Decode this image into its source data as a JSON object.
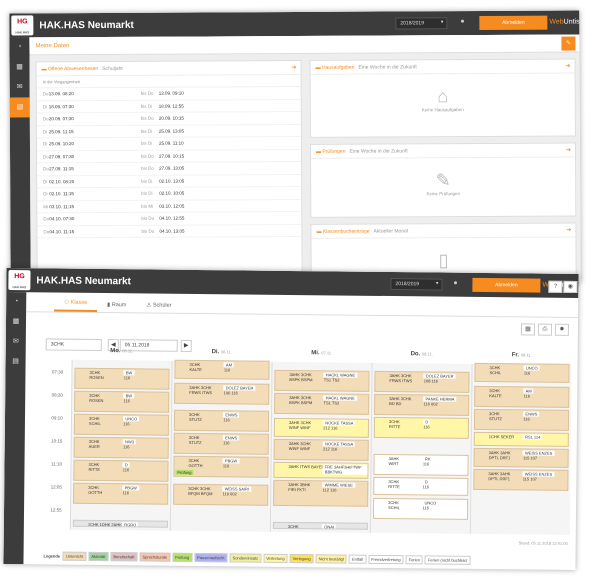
{
  "school": "HAK.HAS Neumarkt",
  "logo": "HG",
  "logo_sub": "HAK.HAS",
  "brand_a": "Web",
  "brand_b": "Untis",
  "year": "2018/2019",
  "logout": "Abmelden",
  "w1": {
    "title": "Meine Daten",
    "absences": {
      "title": "Offene Abwesenheiten",
      "subtitle": "Schuljahr",
      "section": "In der Vergangenheit",
      "rows": [
        [
          "Do",
          "13.09.",
          "08:20",
          "bis Do",
          "13.09.",
          "09:10"
        ],
        [
          "Di",
          "18.09.",
          "07:30",
          "bis Di",
          "18.09.",
          "12:55"
        ],
        [
          "Do",
          "20.09.",
          "07:30",
          "bis Do",
          "20.09.",
          "10:15"
        ],
        [
          "Di",
          "25.09.",
          "11:15",
          "bis Di",
          "25.09.",
          "13:05"
        ],
        [
          "Di",
          "25.09.",
          "10:20",
          "bis Di",
          "25.09.",
          "11:10"
        ],
        [
          "Do",
          "27.09.",
          "07:30",
          "bis Do",
          "27.09.",
          "10:15"
        ],
        [
          "Do",
          "27.09.",
          "11:15",
          "bis Do",
          "27.09.",
          "13:05"
        ],
        [
          "Di",
          "02.10.",
          "08:20",
          "bis Di",
          "02.10.",
          "13:05"
        ],
        [
          "Di",
          "02.10.",
          "11:15",
          "bis Di",
          "02.10.",
          "10:05"
        ],
        [
          "Mi",
          "03.10.",
          "11:15",
          "bis Mi",
          "03.10.",
          "12:05"
        ],
        [
          "Do",
          "04.10.",
          "07:30",
          "bis Do",
          "04.10.",
          "12:55"
        ],
        [
          "Do",
          "04.10.",
          "11:15",
          "bis Do",
          "04.10.",
          "13:05"
        ]
      ]
    },
    "homework": {
      "title": "Hausaufgaben",
      "subtitle": "Eine Woche in die Zukunft",
      "empty": "Keine Hausaufgaben"
    },
    "exams": {
      "title": "Prüfungen",
      "subtitle": "Eine Woche in die Zukunft",
      "empty": "Keine Prüfungen"
    },
    "classbook": {
      "title": "Klassenbucheinträge",
      "subtitle": "Aktueller Monat"
    }
  },
  "w2": {
    "tabs": [
      "Klasse",
      "Raum",
      "Schüler"
    ],
    "class_select": "3CHK",
    "date": "05.11.2018",
    "days": [
      {
        "d": "Mo.",
        "dt": "05.11."
      },
      {
        "d": "Di.",
        "dt": "06.11."
      },
      {
        "d": "Mi.",
        "dt": "07.11."
      },
      {
        "d": "Do.",
        "dt": "08.11."
      },
      {
        "d": "Fr.",
        "dt": "09.11."
      }
    ],
    "times": [
      "07:30",
      "08:20",
      "09:10",
      "10:15",
      "11:10",
      "12:05",
      "12:55"
    ],
    "stand": "Stand: 05.11.2018 13:41:00",
    "legend_title": "Legende",
    "legend": [
      {
        "t": "Unterricht",
        "c": "#f3ddb8"
      },
      {
        "t": "Aktivität",
        "c": "#9fd39f"
      },
      {
        "t": "Bereitschaft",
        "c": "#e0c0c0"
      },
      {
        "t": "Sprechstunde",
        "c": "#f6c3b0"
      },
      {
        "t": "Prüfung",
        "c": "#b5e06b"
      },
      {
        "t": "Pausenaufsicht",
        "c": "#b0b0ef"
      },
      {
        "t": "Sondereinsatz",
        "c": "#f0f0a0"
      },
      {
        "t": "Vertretung",
        "c": "#fff6a8"
      },
      {
        "t": "Verlegung",
        "c": "#ffe04f"
      },
      {
        "t": "Nicht bestätigt",
        "c": "#fff3a0"
      },
      {
        "t": "Entfall",
        "c": "#fff"
      },
      {
        "t": "Fremdvertretung",
        "c": "#fff"
      },
      {
        "t": "Ferien",
        "c": "#fff"
      },
      {
        "t": "Ferien (nicht buchbar)",
        "c": "#fff"
      }
    ],
    "lessons": [
      {
        "day": 0,
        "s": 0,
        "l": 1,
        "cls": "3CHK",
        "sub": "ROSEN",
        "rm": "BW",
        "tc": "116"
      },
      {
        "day": 0,
        "s": 1,
        "l": 1,
        "cls": "3CHK",
        "sub": "ROSEN",
        "rm": "BW",
        "tc": "116"
      },
      {
        "day": 0,
        "s": 2,
        "l": 1,
        "cls": "3CHK",
        "sub": "SCHIL",
        "rm": "UNCO",
        "tc": "116"
      },
      {
        "day": 0,
        "s": 3,
        "l": 1,
        "cls": "3CHK",
        "sub": "AUER",
        "rm": "NW3",
        "tc": "116"
      },
      {
        "day": 0,
        "s": 4,
        "l": 1,
        "cls": "3CHK",
        "sub": "RITTE",
        "rm": "D",
        "tc": "116"
      },
      {
        "day": 0,
        "s": 5,
        "l": 1,
        "cls": "3CHK",
        "sub": "GOTTH",
        "rm": "PBGW",
        "tc": "116"
      },
      {
        "day": 0,
        "s": 6.6,
        "l": 0.4,
        "cls": "1CHK 1DHK 2AHK",
        "sub": "",
        "rm": "RGRO",
        "tc": "",
        "g": 1
      },
      {
        "day": 1,
        "s": -0.4,
        "l": 0.9,
        "cls": "3CHK",
        "sub": "KALTE",
        "rm": "AM",
        "tc": "116"
      },
      {
        "day": 1,
        "s": 0.6,
        "l": 1,
        "cls": "3AHK 3CHK",
        "sub": "FRWS ITWS",
        "rm": "DOLEZ BAYER",
        "tc": "106 116"
      },
      {
        "day": 1,
        "s": 1.8,
        "l": 1,
        "cls": "3CHK",
        "sub": "STUTZ",
        "rm": "ENWS",
        "tc": "116"
      },
      {
        "day": 1,
        "s": 2.8,
        "l": 1,
        "cls": "3CHK",
        "sub": "STUTZ",
        "rm": "ENWS",
        "tc": "116"
      },
      {
        "day": 1,
        "s": 3.8,
        "l": 1,
        "cls": "3CHK",
        "sub": "GOTTH",
        "rm": "PBGW",
        "tc": "116",
        "p": 1
      },
      {
        "day": 1,
        "s": 5,
        "l": 1,
        "cls": "3CHK 3CHK",
        "sub": "BFQM BFQM",
        "rm": "WEISS SAIRI",
        "tc": "116 002"
      },
      {
        "day": 2,
        "s": 0,
        "l": 1,
        "cls": "3AHK 3CHK",
        "sub": "BSPK BSPM",
        "rm": "HACKL WAGNE",
        "tc": "TS1 TS2"
      },
      {
        "day": 2,
        "s": 1,
        "l": 1,
        "cls": "3AHK 3CHK",
        "sub": "BSPK BSPM",
        "rm": "HACKL WAGNE",
        "tc": "TS1 TS2"
      },
      {
        "day": 2,
        "s": 2.1,
        "l": 0.9,
        "cls": "3AHK 3CHK",
        "sub": "WINF WINF",
        "rm": "NOCKE TASSA",
        "tc": "212 116",
        "y": 1
      },
      {
        "day": 2,
        "s": 3,
        "l": 1,
        "cls": "3AHK 3CHK",
        "sub": "WINF WINF",
        "rm": "NOCKE TASSA",
        "tc": "212 116"
      },
      {
        "day": 2,
        "s": 4,
        "l": 0.8,
        "cls": "3AHK ITWS BAYER",
        "sub": "",
        "rm": "FRE 3AHF3HIFTWF BBKTWG",
        "tc": "",
        "y": 1
      },
      {
        "day": 2,
        "s": 4.8,
        "l": 1.2,
        "cls": "3AHK 3BHK",
        "sub": "FIRI FKTI",
        "rm": "WIMME WIESE",
        "tc": "112 116"
      },
      {
        "day": 2,
        "s": 6.6,
        "l": 0.4,
        "cls": "3CHK",
        "sub": "",
        "rm": "ONAI",
        "tc": "",
        "g": 1
      },
      {
        "day": 3,
        "s": 0,
        "l": 1,
        "cls": "3AHK 3CHK",
        "sub": "FRWS ITWS",
        "rm": "DOLEZ BAYER",
        "tc": "108 116"
      },
      {
        "day": 3,
        "s": 1,
        "l": 1,
        "cls": "3AHK 3CHK",
        "sub": "BD BD",
        "rm": "PANKE HERMA",
        "tc": "116 002"
      },
      {
        "day": 3,
        "s": 2,
        "l": 1,
        "cls": "3CHK",
        "sub": "RITTE",
        "rm": "D",
        "tc": "116",
        "y": 1
      },
      {
        "day": 3,
        "s": 3.6,
        "l": 1,
        "cls": "3AHK",
        "sub": "WIRT",
        "rm": "RK",
        "tc": "116",
        "w": 1
      },
      {
        "day": 3,
        "s": 4.6,
        "l": 0.9,
        "cls": "3CHK",
        "sub": "RITTE",
        "rm": "D",
        "tc": "116",
        "w": 1
      },
      {
        "day": 3,
        "s": 5.5,
        "l": 1,
        "cls": "3CHK",
        "sub": "SCHIL",
        "rm": "UNCO",
        "tc": "116",
        "w": 1
      },
      {
        "day": 4,
        "s": -0.4,
        "l": 0.9,
        "cls": "3CHK",
        "sub": "SCHIL",
        "rm": "UNCO",
        "tc": "116"
      },
      {
        "day": 4,
        "s": 0.6,
        "l": 1,
        "cls": "3CHK",
        "sub": "KALTE",
        "rm": "AM",
        "tc": "116"
      },
      {
        "day": 4,
        "s": 1.6,
        "l": 1,
        "cls": "3CHK",
        "sub": "STUTZ",
        "rm": "ENWS",
        "tc": "116"
      },
      {
        "day": 4,
        "s": 2.6,
        "l": 0.7,
        "cls": "1CHK SEKER",
        "sub": "",
        "rm": "RSL 114",
        "tc": "",
        "y": 1
      },
      {
        "day": 4,
        "s": 3.3,
        "l": 0.9,
        "cls": "3AHK 3AHK",
        "sub": "DPTL DRF1",
        "rm": "WEISS ENZES",
        "tc": "115 107"
      },
      {
        "day": 4,
        "s": 4.2,
        "l": 1,
        "cls": "3AHK 3AHK",
        "sub": "DPTL DRF1",
        "rm": "WEISS ENZES",
        "tc": "115 107"
      }
    ]
  }
}
